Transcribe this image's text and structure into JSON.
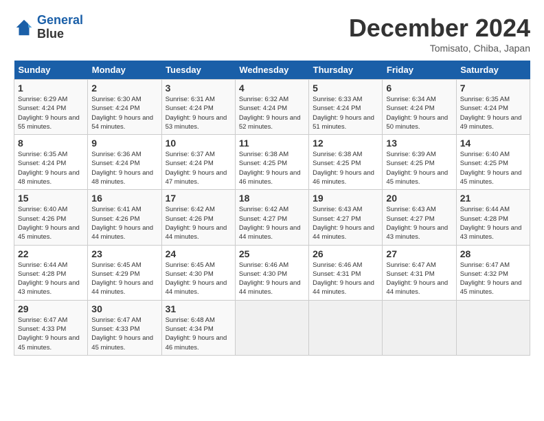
{
  "header": {
    "logo_line1": "General",
    "logo_line2": "Blue",
    "month": "December 2024",
    "location": "Tomisato, Chiba, Japan"
  },
  "days_of_week": [
    "Sunday",
    "Monday",
    "Tuesday",
    "Wednesday",
    "Thursday",
    "Friday",
    "Saturday"
  ],
  "weeks": [
    [
      {
        "day": "1",
        "sunrise": "6:29 AM",
        "sunset": "4:24 PM",
        "daylight": "9 hours and 55 minutes."
      },
      {
        "day": "2",
        "sunrise": "6:30 AM",
        "sunset": "4:24 PM",
        "daylight": "9 hours and 54 minutes."
      },
      {
        "day": "3",
        "sunrise": "6:31 AM",
        "sunset": "4:24 PM",
        "daylight": "9 hours and 53 minutes."
      },
      {
        "day": "4",
        "sunrise": "6:32 AM",
        "sunset": "4:24 PM",
        "daylight": "9 hours and 52 minutes."
      },
      {
        "day": "5",
        "sunrise": "6:33 AM",
        "sunset": "4:24 PM",
        "daylight": "9 hours and 51 minutes."
      },
      {
        "day": "6",
        "sunrise": "6:34 AM",
        "sunset": "4:24 PM",
        "daylight": "9 hours and 50 minutes."
      },
      {
        "day": "7",
        "sunrise": "6:35 AM",
        "sunset": "4:24 PM",
        "daylight": "9 hours and 49 minutes."
      }
    ],
    [
      {
        "day": "8",
        "sunrise": "6:35 AM",
        "sunset": "4:24 PM",
        "daylight": "9 hours and 48 minutes."
      },
      {
        "day": "9",
        "sunrise": "6:36 AM",
        "sunset": "4:24 PM",
        "daylight": "9 hours and 48 minutes."
      },
      {
        "day": "10",
        "sunrise": "6:37 AM",
        "sunset": "4:24 PM",
        "daylight": "9 hours and 47 minutes."
      },
      {
        "day": "11",
        "sunrise": "6:38 AM",
        "sunset": "4:25 PM",
        "daylight": "9 hours and 46 minutes."
      },
      {
        "day": "12",
        "sunrise": "6:38 AM",
        "sunset": "4:25 PM",
        "daylight": "9 hours and 46 minutes."
      },
      {
        "day": "13",
        "sunrise": "6:39 AM",
        "sunset": "4:25 PM",
        "daylight": "9 hours and 45 minutes."
      },
      {
        "day": "14",
        "sunrise": "6:40 AM",
        "sunset": "4:25 PM",
        "daylight": "9 hours and 45 minutes."
      }
    ],
    [
      {
        "day": "15",
        "sunrise": "6:40 AM",
        "sunset": "4:26 PM",
        "daylight": "9 hours and 45 minutes."
      },
      {
        "day": "16",
        "sunrise": "6:41 AM",
        "sunset": "4:26 PM",
        "daylight": "9 hours and 44 minutes."
      },
      {
        "day": "17",
        "sunrise": "6:42 AM",
        "sunset": "4:26 PM",
        "daylight": "9 hours and 44 minutes."
      },
      {
        "day": "18",
        "sunrise": "6:42 AM",
        "sunset": "4:27 PM",
        "daylight": "9 hours and 44 minutes."
      },
      {
        "day": "19",
        "sunrise": "6:43 AM",
        "sunset": "4:27 PM",
        "daylight": "9 hours and 44 minutes."
      },
      {
        "day": "20",
        "sunrise": "6:43 AM",
        "sunset": "4:27 PM",
        "daylight": "9 hours and 43 minutes."
      },
      {
        "day": "21",
        "sunrise": "6:44 AM",
        "sunset": "4:28 PM",
        "daylight": "9 hours and 43 minutes."
      }
    ],
    [
      {
        "day": "22",
        "sunrise": "6:44 AM",
        "sunset": "4:28 PM",
        "daylight": "9 hours and 43 minutes."
      },
      {
        "day": "23",
        "sunrise": "6:45 AM",
        "sunset": "4:29 PM",
        "daylight": "9 hours and 44 minutes."
      },
      {
        "day": "24",
        "sunrise": "6:45 AM",
        "sunset": "4:30 PM",
        "daylight": "9 hours and 44 minutes."
      },
      {
        "day": "25",
        "sunrise": "6:46 AM",
        "sunset": "4:30 PM",
        "daylight": "9 hours and 44 minutes."
      },
      {
        "day": "26",
        "sunrise": "6:46 AM",
        "sunset": "4:31 PM",
        "daylight": "9 hours and 44 minutes."
      },
      {
        "day": "27",
        "sunrise": "6:47 AM",
        "sunset": "4:31 PM",
        "daylight": "9 hours and 44 minutes."
      },
      {
        "day": "28",
        "sunrise": "6:47 AM",
        "sunset": "4:32 PM",
        "daylight": "9 hours and 45 minutes."
      }
    ],
    [
      {
        "day": "29",
        "sunrise": "6:47 AM",
        "sunset": "4:33 PM",
        "daylight": "9 hours and 45 minutes."
      },
      {
        "day": "30",
        "sunrise": "6:47 AM",
        "sunset": "4:33 PM",
        "daylight": "9 hours and 45 minutes."
      },
      {
        "day": "31",
        "sunrise": "6:48 AM",
        "sunset": "4:34 PM",
        "daylight": "9 hours and 46 minutes."
      },
      null,
      null,
      null,
      null
    ]
  ]
}
